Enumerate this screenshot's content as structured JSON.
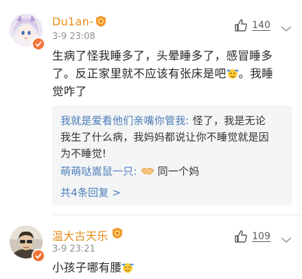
{
  "comments": [
    {
      "username": "Du1an-",
      "time": "3-9 23:08",
      "likes": "140",
      "text_line1": "生病了怪我睡多了，头晕睡多了，感冒睡多",
      "text_line2_a": "了。反正家里就不应该有张床是吧",
      "text_line2_b": "。我睡",
      "text_line3": "觉咋了",
      "replies": [
        {
          "author": "我就是爱看他们亲嘴你管我:",
          "text_a": " 怪了，我是无论",
          "text_line2": "我生了什么病，我妈妈都说让你不睡觉就是因",
          "text_line3": "为不睡觉!"
        },
        {
          "author": "萌萌哒嵩鼠一只:",
          "text": "同一个妈"
        }
      ],
      "more_replies": "共4条回复 >"
    },
    {
      "username": "温大古天乐",
      "time": "3-9 23:21",
      "likes": "109",
      "text_a": "小孩子哪有腰"
    }
  ],
  "icons": {
    "like": "thumb-up-icon",
    "more": "chevron-down-icon",
    "level": "level-badge-icon",
    "verified": "verified-badge-icon"
  },
  "colors": {
    "username": "#e58a18",
    "reply_name": "#4c7db8",
    "meta": "#8f8f8f",
    "reply_bg": "#f4f5f7"
  }
}
